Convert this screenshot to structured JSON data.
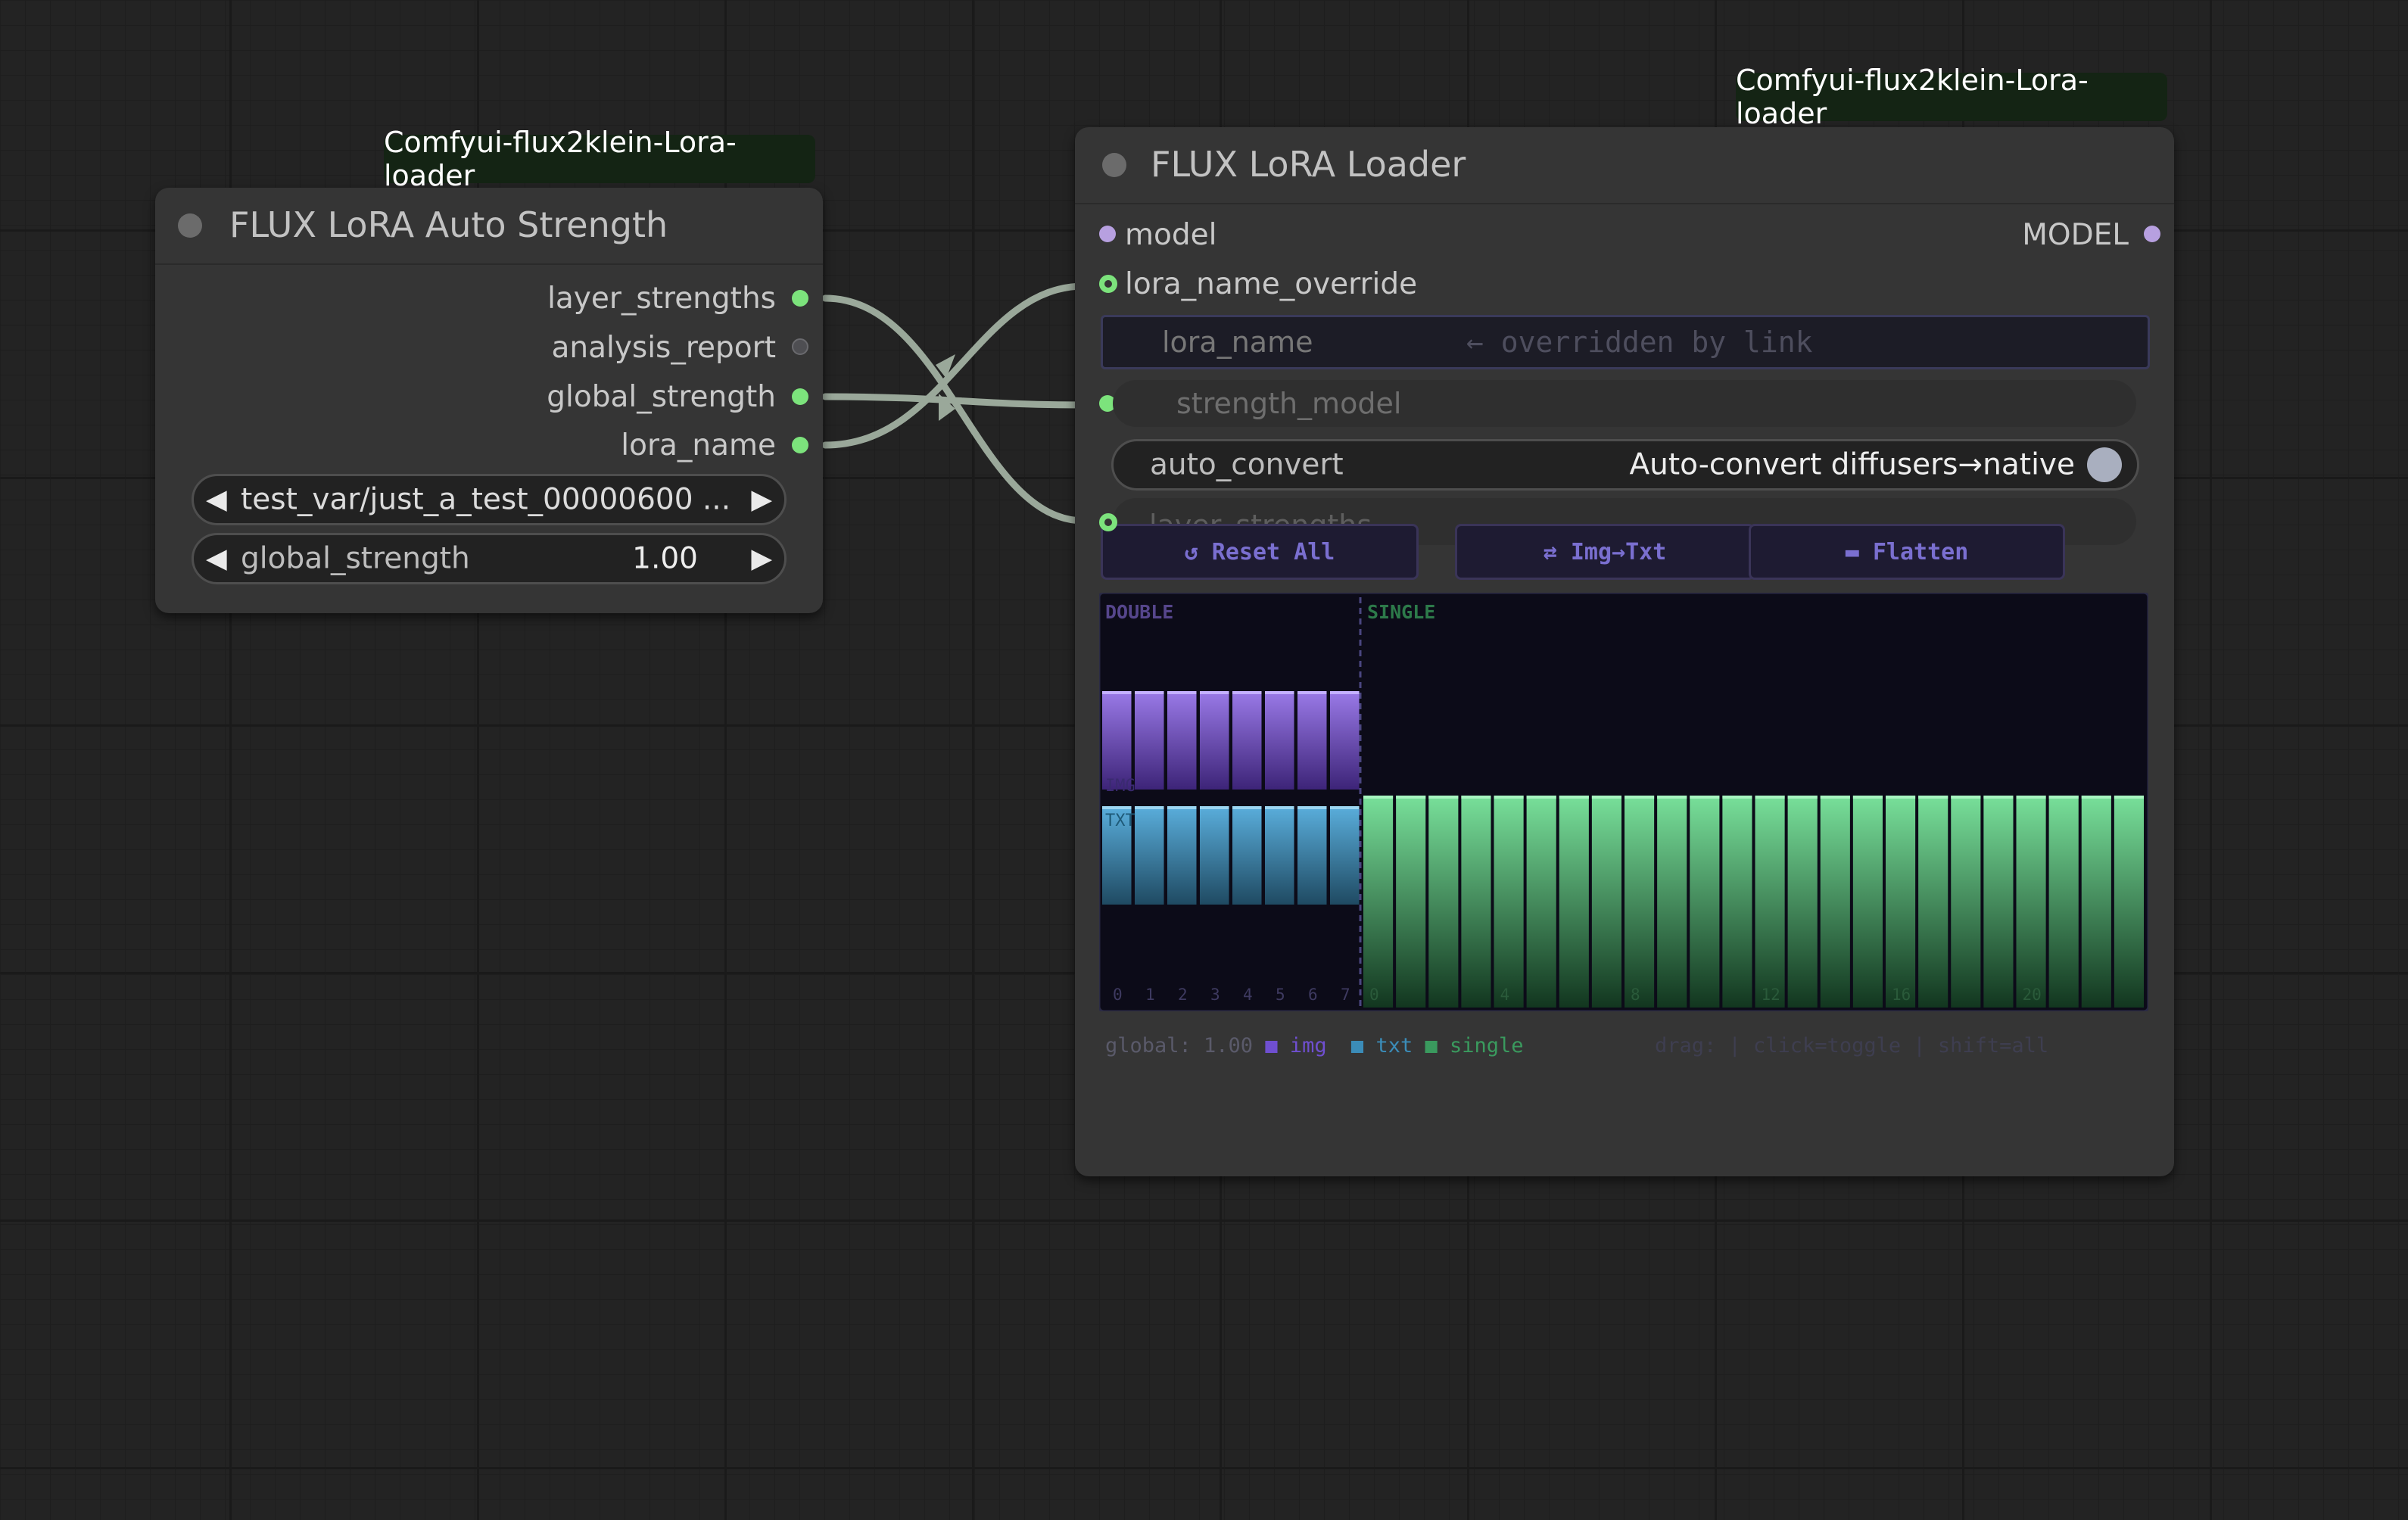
{
  "colors": {
    "canvas": "#232323",
    "node": "#353535",
    "wire": "#9aa89a",
    "slot_green": "#7ce37c",
    "img_bar": "#8e6ad8",
    "txt_bar": "#4a9cc4",
    "single_bar": "#6cd48c"
  },
  "node_auto_strength": {
    "badge": "Comfyui-flux2klein-Lora-loader",
    "title": "FLUX LoRA Auto Strength",
    "outputs": [
      {
        "label": "layer_strengths"
      },
      {
        "label": "analysis_report"
      },
      {
        "label": "global_strength"
      },
      {
        "label": "lora_name"
      }
    ],
    "lora_combo": {
      "value": "test_var/just_a_test_00000600 ..."
    },
    "global_strength": {
      "label": "global_strength",
      "value": "1.00"
    },
    "icons": {
      "left": "triangle-left-icon",
      "right": "triangle-right-icon"
    }
  },
  "node_loader": {
    "badge": "Comfyui-flux2klein-Lora-loader",
    "title": "FLUX LoRA Loader",
    "inputs": {
      "model": "model",
      "lora_name_override": "lora_name_override"
    },
    "output_model": "MODEL",
    "lora_name": {
      "label": "lora_name",
      "placeholder": "← overridden by link"
    },
    "strength_model": {
      "label": "strength_model"
    },
    "auto_convert": {
      "label": "auto_convert",
      "value": "Auto-convert diffusers→native",
      "enabled": true
    },
    "layer_strengths": {
      "label": "layer_strengths"
    },
    "buttons": {
      "reset": "↺ Reset All",
      "img_txt": "⇄ Img→Txt",
      "flatten": "▬ Flatten"
    },
    "legend": {
      "global": "global: 1.00",
      "img": "img",
      "txt": "txt",
      "single": "single",
      "hint": "drag: | click=toggle | shift=all"
    }
  },
  "chart_data": {
    "type": "bar",
    "title": "",
    "sections": [
      "DOUBLE",
      "SINGLE"
    ],
    "double_block_indices": [
      0,
      1,
      2,
      3,
      4,
      5,
      6,
      7
    ],
    "single_block_tick_labels": [
      "0",
      "4",
      "8",
      "12",
      "16",
      "20"
    ],
    "single_block_count": 24,
    "series": [
      {
        "name": "IMG",
        "values": [
          1,
          1,
          1,
          1,
          1,
          1,
          1,
          1
        ]
      },
      {
        "name": "TXT",
        "values": [
          1,
          1,
          1,
          1,
          1,
          1,
          1,
          1
        ]
      },
      {
        "name": "single",
        "values": [
          1,
          1,
          1,
          1,
          1,
          1,
          1,
          1,
          1,
          1,
          1,
          1,
          1,
          1,
          1,
          1,
          1,
          1,
          1,
          1,
          1,
          1,
          1,
          1
        ]
      }
    ],
    "ylim": [
      0,
      1
    ]
  }
}
